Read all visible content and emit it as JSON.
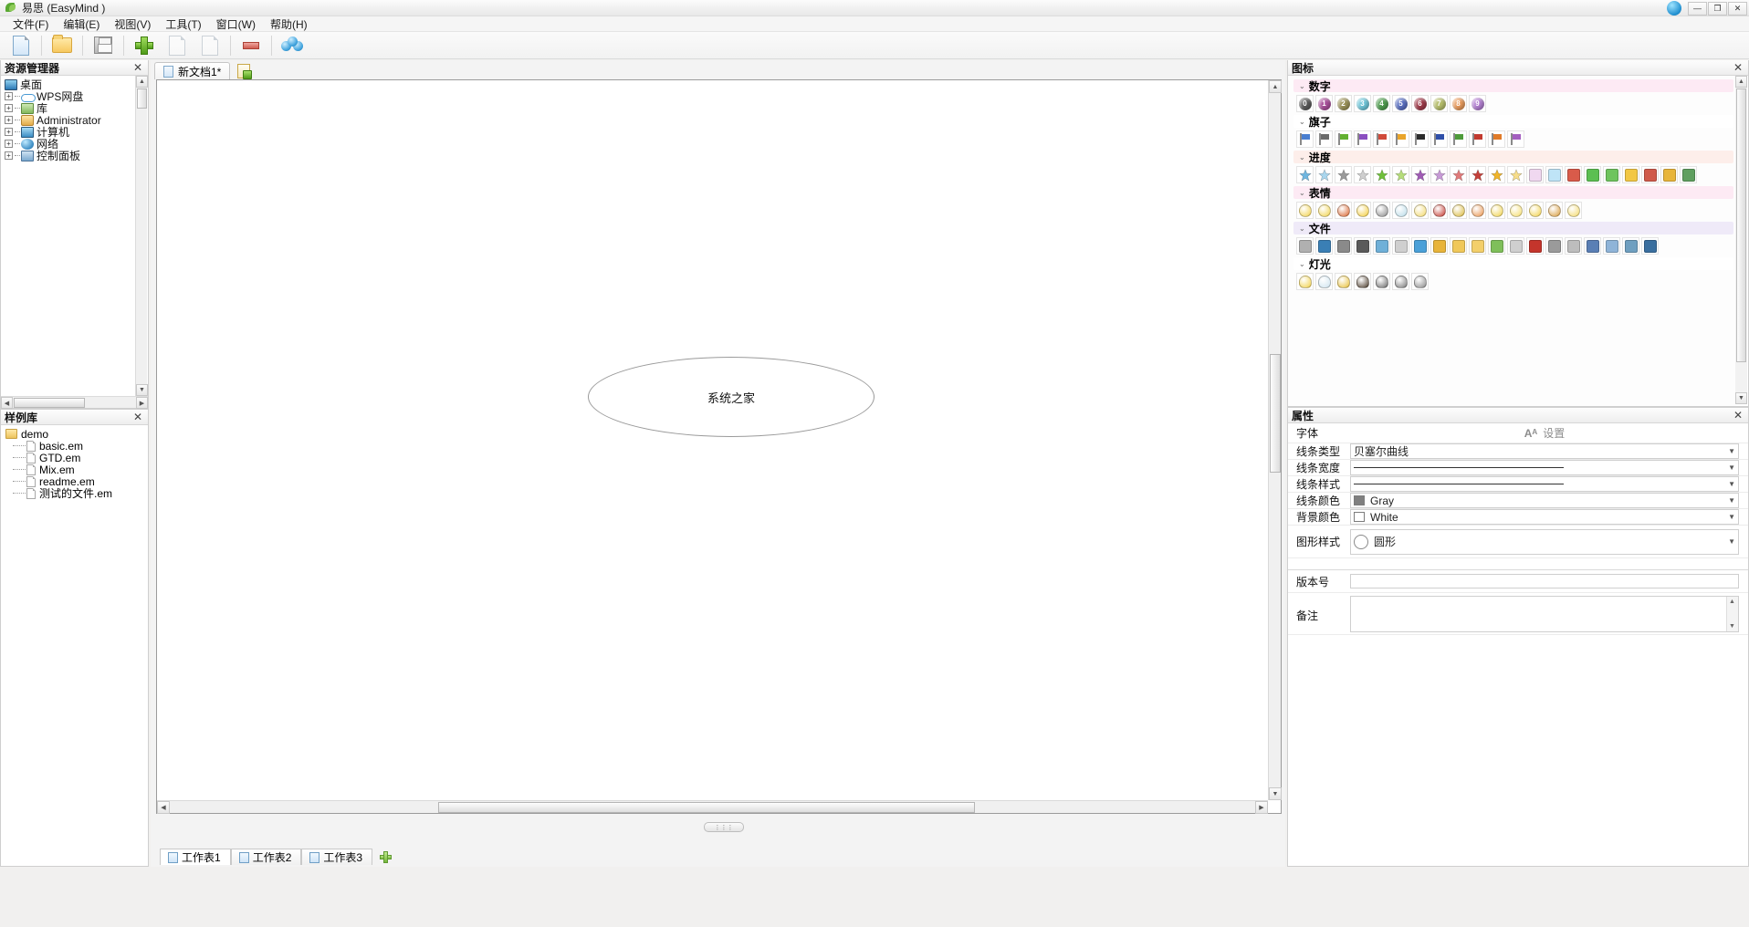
{
  "window": {
    "title": "易思 (EasyMind )",
    "app_icon": "leaf-icon",
    "sys_buttons": [
      "minimize",
      "maximize",
      "close"
    ],
    "minimize_glyph": "—",
    "maximize_glyph": "❐",
    "close_glyph": "✕"
  },
  "menu": {
    "items": [
      {
        "label": "文件(F)"
      },
      {
        "label": "编辑(E)"
      },
      {
        "label": "视图(V)"
      },
      {
        "label": "工具(T)"
      },
      {
        "label": "窗口(W)"
      },
      {
        "label": "帮助(H)"
      }
    ]
  },
  "toolbar": {
    "buttons": [
      {
        "name": "new-document-button",
        "icon": "new-document-icon"
      },
      {
        "name": "open-button",
        "icon": "folder-open-icon"
      },
      {
        "name": "save-button",
        "icon": "floppy-save-icon"
      },
      {
        "name": "add-node-button",
        "icon": "green-plus-icon"
      },
      {
        "name": "add-sibling-button",
        "icon": "green-right-arrow-icon"
      },
      {
        "name": "add-child-button",
        "icon": "green-down-arrow-icon"
      },
      {
        "name": "delete-node-button",
        "icon": "red-minus-icon"
      },
      {
        "name": "share-button",
        "icon": "blue-people-icon"
      }
    ]
  },
  "explorer": {
    "title": "资源管理器",
    "close_glyph": "✕",
    "tree": [
      {
        "label": "桌面",
        "icon": "monitor-icon",
        "depth": 0,
        "expander": ""
      },
      {
        "label": "WPS网盘",
        "icon": "cloud-icon",
        "depth": 1,
        "expander": "+"
      },
      {
        "label": "库",
        "icon": "library-icon",
        "depth": 1,
        "expander": "+"
      },
      {
        "label": "Administrator",
        "icon": "user-icon",
        "depth": 1,
        "expander": "+"
      },
      {
        "label": "计算机",
        "icon": "computer-icon",
        "depth": 1,
        "expander": "+"
      },
      {
        "label": "网络",
        "icon": "network-icon",
        "depth": 1,
        "expander": "+"
      },
      {
        "label": "控制面板",
        "icon": "control-panel-icon",
        "depth": 1,
        "expander": "+"
      }
    ]
  },
  "samples": {
    "title": "样例库",
    "close_glyph": "✕",
    "root": {
      "label": "demo",
      "icon": "folder-icon"
    },
    "files": [
      {
        "label": "basic.em"
      },
      {
        "label": "GTD.em"
      },
      {
        "label": "Mix.em"
      },
      {
        "label": "readme.em"
      },
      {
        "label": "测试的文件.em"
      }
    ]
  },
  "editor": {
    "tab": {
      "label": "新文档1*",
      "icon": "document-icon"
    },
    "new_sheet_button": "new-sheet-icon",
    "node": {
      "text": "系统之家"
    },
    "split_grip": "⋮⋮⋮",
    "sheet_tabs": [
      {
        "label": "工作表1",
        "active": true
      },
      {
        "label": "工作表2",
        "active": false
      },
      {
        "label": "工作表3",
        "active": false
      }
    ],
    "add_sheet_label": "+"
  },
  "icons_panel": {
    "title": "图标",
    "close_glyph": "✕",
    "chevron": "⌄",
    "categories": [
      {
        "name": "数字",
        "style": "cat-num",
        "icons": [
          {
            "type": "badge",
            "label": "0",
            "color": "#5a5a5a"
          },
          {
            "type": "badge",
            "label": "1",
            "color": "#a8509a"
          },
          {
            "type": "badge",
            "label": "2",
            "color": "#9a9158"
          },
          {
            "type": "badge",
            "label": "3",
            "color": "#6fc5d8"
          },
          {
            "type": "badge",
            "label": "4",
            "color": "#4e9b4e"
          },
          {
            "type": "badge",
            "label": "5",
            "color": "#5a6fc0"
          },
          {
            "type": "badge",
            "label": "6",
            "color": "#9e3b4a"
          },
          {
            "type": "badge",
            "label": "7",
            "color": "#b5bd6a"
          },
          {
            "type": "badge",
            "label": "8",
            "color": "#e79a5c"
          },
          {
            "type": "badge",
            "label": "9",
            "color": "#b27fd0"
          }
        ]
      },
      {
        "name": "旗子",
        "style": "cat-flag",
        "icons": [
          {
            "type": "flag",
            "color": "#4a7fd0"
          },
          {
            "type": "flag",
            "color": "#6b6b6b"
          },
          {
            "type": "flag",
            "color": "#62b030"
          },
          {
            "type": "flag",
            "color": "#8a4fc0"
          },
          {
            "type": "flag",
            "color": "#d04a3a"
          },
          {
            "type": "flag",
            "color": "#e9a42a"
          },
          {
            "type": "flag",
            "color": "#2b2b2b"
          },
          {
            "type": "flag",
            "color": "#2f4fa8"
          },
          {
            "type": "flag",
            "color": "#4e9b3a"
          },
          {
            "type": "flag",
            "color": "#c23a2f"
          },
          {
            "type": "flag",
            "color": "#e07a28"
          },
          {
            "type": "flag",
            "color": "#a45fc0"
          }
        ]
      },
      {
        "name": "进度",
        "style": "cat-prog",
        "icons": [
          {
            "type": "star",
            "color": "#6fb6e0"
          },
          {
            "type": "star",
            "color": "#a9d6ee"
          },
          {
            "type": "star",
            "color": "#9a9a9a"
          },
          {
            "type": "star",
            "color": "#cfcfcf"
          },
          {
            "type": "star",
            "color": "#6fc03a"
          },
          {
            "type": "star",
            "color": "#b5dd7a"
          },
          {
            "type": "star",
            "color": "#a05bb5"
          },
          {
            "type": "star",
            "color": "#c79ad6"
          },
          {
            "type": "star",
            "color": "#e07a7a"
          },
          {
            "type": "star",
            "color": "#c4403a"
          },
          {
            "type": "star",
            "color": "#f0b429"
          },
          {
            "type": "star",
            "color": "#f7dd8a"
          },
          {
            "type": "tile",
            "color": "#f0d8f0"
          },
          {
            "type": "tile",
            "color": "#bfe4f7"
          },
          {
            "type": "tile",
            "color": "#d95b4a"
          },
          {
            "type": "tile",
            "color": "#5cbf52"
          },
          {
            "type": "tile",
            "color": "#6fc45e"
          },
          {
            "type": "tile",
            "color": "#f2c744"
          },
          {
            "type": "tile",
            "color": "#d05a4a"
          },
          {
            "type": "tile",
            "color": "#e8b53a"
          },
          {
            "type": "tile",
            "color": "#5f9f5f"
          }
        ]
      },
      {
        "name": "表情",
        "style": "cat-face",
        "icons": [
          {
            "type": "smiley",
            "color": "#f2d24a"
          },
          {
            "type": "smiley",
            "color": "#f0d24a"
          },
          {
            "type": "smiley",
            "color": "#d8632c"
          },
          {
            "type": "smiley",
            "color": "#f2cc3a"
          },
          {
            "type": "smiley",
            "color": "#8a8a8a"
          },
          {
            "type": "smiley",
            "color": "#b9dbe8"
          },
          {
            "type": "smiley",
            "color": "#f3d96a"
          },
          {
            "type": "smiley",
            "color": "#c3362c"
          },
          {
            "type": "smiley",
            "color": "#d9b83a"
          },
          {
            "type": "smiley",
            "color": "#e8924a"
          },
          {
            "type": "smiley",
            "color": "#f0d24a"
          },
          {
            "type": "smiley",
            "color": "#f5dd6a"
          },
          {
            "type": "smiley",
            "color": "#f2d24a"
          },
          {
            "type": "smiley",
            "color": "#d79a3a"
          },
          {
            "type": "smiley",
            "color": "#f3d96a"
          }
        ]
      },
      {
        "name": "文件",
        "style": "cat-file",
        "icons": [
          {
            "type": "file",
            "color": "#b0b0b0"
          },
          {
            "type": "file",
            "color": "#3a7fb5"
          },
          {
            "type": "file",
            "color": "#8a8a8a"
          },
          {
            "type": "file",
            "color": "#5a5a5a"
          },
          {
            "type": "file",
            "color": "#6fb0d8"
          },
          {
            "type": "file",
            "color": "#cfcfcf"
          },
          {
            "type": "file",
            "color": "#4aa0d8"
          },
          {
            "type": "file",
            "color": "#e8b43a"
          },
          {
            "type": "file",
            "color": "#f0c85a"
          },
          {
            "type": "file",
            "color": "#f3cf6a"
          },
          {
            "type": "file",
            "color": "#7fbf5a"
          },
          {
            "type": "file",
            "color": "#cfcfcf"
          },
          {
            "type": "file",
            "color": "#c4352c"
          },
          {
            "type": "file",
            "color": "#9a9a9a"
          },
          {
            "type": "file",
            "color": "#bdbdbd"
          },
          {
            "type": "file",
            "color": "#5a7fb5"
          },
          {
            "type": "file",
            "color": "#8fb4d8"
          },
          {
            "type": "file",
            "color": "#6f9fc0"
          },
          {
            "type": "file",
            "color": "#3a6f9f"
          }
        ]
      },
      {
        "name": "灯光",
        "style": "cat-light",
        "icons": [
          {
            "type": "bulb",
            "color": "#f2d24a"
          },
          {
            "type": "bulb",
            "color": "#cfe4f0"
          },
          {
            "type": "bulb",
            "color": "#e8c03a"
          },
          {
            "type": "bulb",
            "color": "#4a3a2a"
          },
          {
            "type": "bulb",
            "color": "#6a6a6a"
          },
          {
            "type": "bulb",
            "color": "#7a7a7a"
          },
          {
            "type": "bulb",
            "color": "#8a8a8a"
          }
        ]
      }
    ]
  },
  "properties": {
    "title": "属性",
    "close_glyph": "✕",
    "font_label": "字体",
    "font_button": "设置",
    "font_icon": "font-icon",
    "rows": [
      {
        "label": "线条类型",
        "value": "贝塞尔曲线",
        "kind": "select"
      },
      {
        "label": "线条宽度",
        "value": "",
        "kind": "line"
      },
      {
        "label": "线条样式",
        "value": "",
        "kind": "line"
      },
      {
        "label": "线条颜色",
        "value": "Gray",
        "kind": "color",
        "swatch": "#808080"
      },
      {
        "label": "背景颜色",
        "value": "White",
        "kind": "color",
        "swatch": "#ffffff"
      }
    ],
    "shape_row": {
      "label": "图形样式",
      "value": "圆形",
      "kind": "shape"
    },
    "version_row": {
      "label": "版本号",
      "value": ""
    },
    "note_row": {
      "label": "备注",
      "value": ""
    },
    "caret_glyph": "▼",
    "up_glyph": "▲",
    "down_glyph": "▼"
  }
}
